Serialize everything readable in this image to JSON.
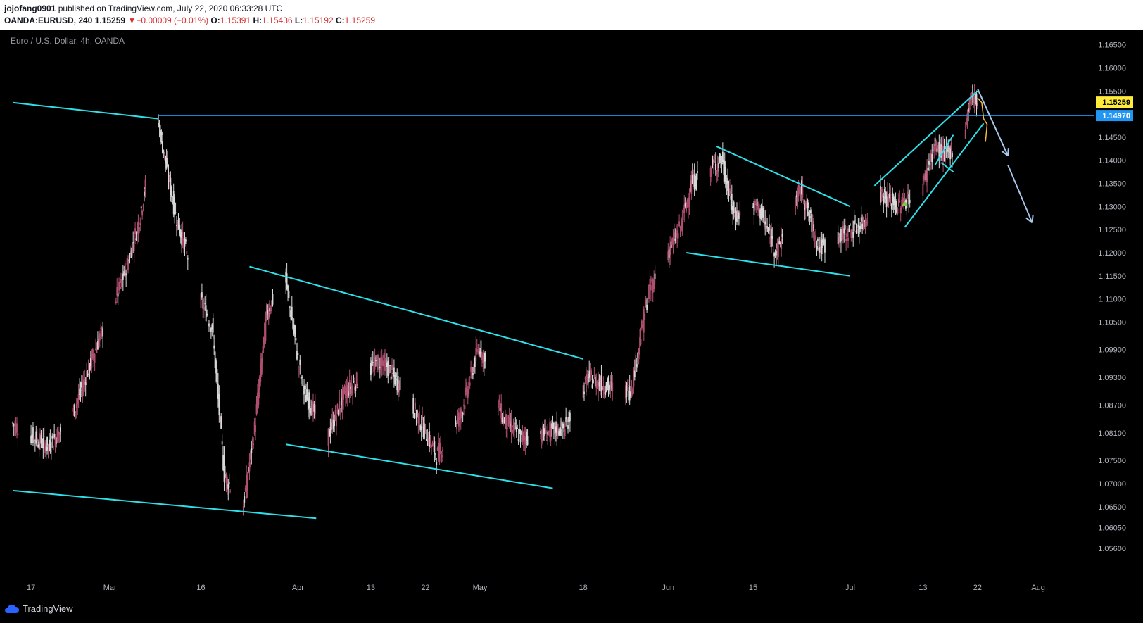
{
  "header": {
    "author": "jojofang0901",
    "published_text": " published on TradingView.com, July 22, 2020 06:33:28 UTC",
    "symbol": "OANDA:EURUSD, 240",
    "last": "1.15259",
    "change": "−0.00009 (−0.01%)",
    "o_label": "O:",
    "o_value": "1.15391",
    "h_label": "H:",
    "h_value": "1.15436",
    "l_label": "L:",
    "l_value": "1.15192",
    "c_label": "C:",
    "c_value": "1.15259"
  },
  "chart_title": "Euro / U.S. Dollar, 4h, OANDA",
  "footer": {
    "brand": "TradingView"
  },
  "colors": {
    "background": "#000000",
    "up_candle": "#b0506e",
    "down_candle": "#d9d9d9",
    "trendline": "#2ee0ea",
    "horizontal_line": "#2196f3",
    "arrow": "#a9c7ec",
    "current_price_tag": "#ffeb3b",
    "level_tag": "#2196f3",
    "path_yellow": "#f5b942"
  },
  "chart_data": {
    "type": "candlestick",
    "symbol": "EURUSD",
    "timeframe": "4h",
    "title": "Euro / U.S. Dollar, 4h, OANDA",
    "x_tick_labels": [
      "17",
      "Mar",
      "16",
      "Apr",
      "13",
      "22",
      "May",
      "18",
      "Jun",
      "15",
      "Jul",
      "13",
      "22",
      "Aug"
    ],
    "y_tick_labels": [
      "1.16500",
      "1.16000",
      "1.15500",
      "1.15000",
      "1.14500",
      "1.14000",
      "1.13500",
      "1.13000",
      "1.12500",
      "1.12000",
      "1.11500",
      "1.11000",
      "1.10500",
      "1.09900",
      "1.09300",
      "1.08700",
      "1.08100",
      "1.07500",
      "1.07000",
      "1.06500",
      "1.06050",
      "1.05600"
    ],
    "ylim": [
      1.054,
      1.168
    ],
    "current_price": "1.15259",
    "horizontal_level": "1.14970",
    "price_path": [
      {
        "date": "2020-02-14",
        "price": 1.083
      },
      {
        "date": "2020-02-20",
        "price": 1.078
      },
      {
        "date": "2020-02-24",
        "price": 1.085
      },
      {
        "date": "2020-02-28",
        "price": 1.1
      },
      {
        "date": "2020-03-03",
        "price": 1.113
      },
      {
        "date": "2020-03-06",
        "price": 1.127
      },
      {
        "date": "2020-03-09",
        "price": 1.149
      },
      {
        "date": "2020-03-12",
        "price": 1.128
      },
      {
        "date": "2020-03-16",
        "price": 1.11
      },
      {
        "date": "2020-03-18",
        "price": 1.104
      },
      {
        "date": "2020-03-20",
        "price": 1.072
      },
      {
        "date": "2020-03-23",
        "price": 1.064
      },
      {
        "date": "2020-03-25",
        "price": 1.082
      },
      {
        "date": "2020-03-27",
        "price": 1.107
      },
      {
        "date": "2020-03-30",
        "price": 1.115
      },
      {
        "date": "2020-04-02",
        "price": 1.09
      },
      {
        "date": "2020-04-06",
        "price": 1.08
      },
      {
        "date": "2020-04-09",
        "price": 1.09
      },
      {
        "date": "2020-04-15",
        "price": 1.097
      },
      {
        "date": "2020-04-20",
        "price": 1.087
      },
      {
        "date": "2020-04-24",
        "price": 1.076
      },
      {
        "date": "2020-04-28",
        "price": 1.085
      },
      {
        "date": "2020-05-01",
        "price": 1.1
      },
      {
        "date": "2020-05-05",
        "price": 1.084
      },
      {
        "date": "2020-05-08",
        "price": 1.08
      },
      {
        "date": "2020-05-12",
        "price": 1.081
      },
      {
        "date": "2020-05-15",
        "price": 1.082
      },
      {
        "date": "2020-05-19",
        "price": 1.093
      },
      {
        "date": "2020-05-22",
        "price": 1.091
      },
      {
        "date": "2020-05-26",
        "price": 1.09
      },
      {
        "date": "2020-05-29",
        "price": 1.112
      },
      {
        "date": "2020-06-03",
        "price": 1.125
      },
      {
        "date": "2020-06-05",
        "price": 1.135
      },
      {
        "date": "2020-06-10",
        "price": 1.14
      },
      {
        "date": "2020-06-12",
        "price": 1.128
      },
      {
        "date": "2020-06-16",
        "price": 1.13
      },
      {
        "date": "2020-06-19",
        "price": 1.12
      },
      {
        "date": "2020-06-23",
        "price": 1.134
      },
      {
        "date": "2020-06-26",
        "price": 1.121
      },
      {
        "date": "2020-06-30",
        "price": 1.124
      },
      {
        "date": "2020-07-03",
        "price": 1.126
      },
      {
        "date": "2020-07-06",
        "price": 1.133
      },
      {
        "date": "2020-07-09",
        "price": 1.13
      },
      {
        "date": "2020-07-13",
        "price": 1.134
      },
      {
        "date": "2020-07-15",
        "price": 1.143
      },
      {
        "date": "2020-07-17",
        "price": 1.141
      },
      {
        "date": "2020-07-20",
        "price": 1.146
      },
      {
        "date": "2020-07-21",
        "price": 1.154
      },
      {
        "date": "2020-07-22",
        "price": 1.1526
      }
    ],
    "trendlines": [
      {
        "from": {
          "date": "2020-02-14",
          "price": 1.1525
        },
        "to": {
          "date": "2020-03-09",
          "price": 1.149
        }
      },
      {
        "from": {
          "date": "2020-02-14",
          "price": 1.0685
        },
        "to": {
          "date": "2020-04-04",
          "price": 1.0625
        }
      },
      {
        "from": {
          "date": "2020-03-24",
          "price": 1.117
        },
        "to": {
          "date": "2020-05-18",
          "price": 1.097
        }
      },
      {
        "from": {
          "date": "2020-03-30",
          "price": 1.0785
        },
        "to": {
          "date": "2020-05-13",
          "price": 1.069
        }
      },
      {
        "from": {
          "date": "2020-06-09",
          "price": 1.143
        },
        "to": {
          "date": "2020-07-01",
          "price": 1.13
        }
      },
      {
        "from": {
          "date": "2020-06-04",
          "price": 1.12
        },
        "to": {
          "date": "2020-07-01",
          "price": 1.115
        }
      },
      {
        "from": {
          "date": "2020-07-05",
          "price": 1.1345
        },
        "to": {
          "date": "2020-07-22",
          "price": 1.155
        }
      },
      {
        "from": {
          "date": "2020-07-10",
          "price": 1.1255
        },
        "to": {
          "date": "2020-07-23",
          "price": 1.148
        }
      },
      {
        "from": {
          "date": "2020-07-15",
          "price": 1.139
        },
        "to": {
          "date": "2020-07-18",
          "price": 1.1455
        }
      },
      {
        "from": {
          "date": "2020-07-16",
          "price": 1.1395
        },
        "to": {
          "date": "2020-07-18",
          "price": 1.1375
        }
      }
    ],
    "projection_arrows": [
      {
        "from": {
          "date": "2020-07-22",
          "price": 1.1555
        },
        "to": {
          "date": "2020-07-27",
          "price": 1.141
        }
      },
      {
        "from": {
          "date": "2020-07-27",
          "price": 1.139
        },
        "to": {
          "date": "2020-07-31",
          "price": 1.1265
        }
      }
    ],
    "grid": false,
    "legend": "none"
  }
}
